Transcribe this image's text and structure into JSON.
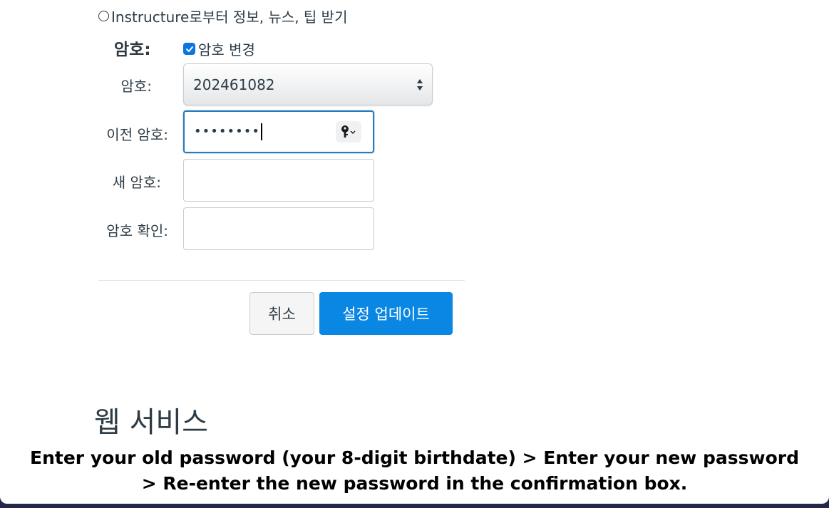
{
  "newsletter": {
    "label": "Instructure로부터 정보, 뉴스, 팁 받기",
    "checked": false
  },
  "password_section": {
    "section_label": "암호:",
    "change_password_label": "암호 변경",
    "change_password_checked": true
  },
  "fields": {
    "password_select": {
      "label": "암호:",
      "value": "202461082"
    },
    "old_password": {
      "label": "이전 암호:",
      "masked_value": "••••••••",
      "key_icon": "key-icon"
    },
    "new_password": {
      "label": "새 암호:",
      "value": ""
    },
    "confirm_password": {
      "label": "암호 확인:",
      "value": ""
    }
  },
  "buttons": {
    "cancel_label": "취소",
    "update_label": "설정 업데이트"
  },
  "colors": {
    "primary": "#0a86e3",
    "focus_border": "#2b7abc",
    "text": "#2d3b45"
  },
  "web_services_heading": "웹 서비스",
  "caption": {
    "line1": "Enter your old password (your 8-digit birthdate) > Enter your new password",
    "line2": "> Re-enter the new password in the confirmation box."
  }
}
